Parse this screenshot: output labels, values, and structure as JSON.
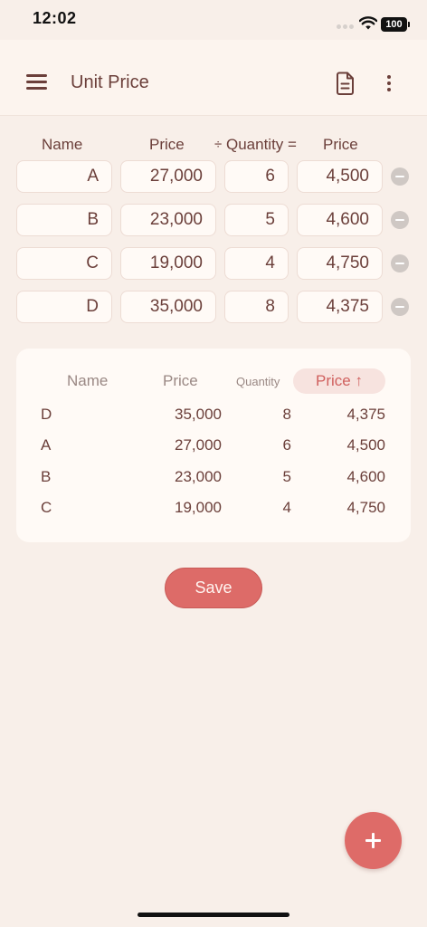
{
  "status_bar": {
    "time": "12:02",
    "battery": "100"
  },
  "app_bar": {
    "title": "Unit Price"
  },
  "input_table": {
    "headers": {
      "name": "Name",
      "price": "Price",
      "divide": "÷",
      "quantity": "Quantity",
      "equals": "=",
      "unit_price": "Price"
    },
    "rows": [
      {
        "name": "A",
        "price": "27,000",
        "quantity": "6",
        "unit_price": "4,500"
      },
      {
        "name": "B",
        "price": "23,000",
        "quantity": "5",
        "unit_price": "4,600"
      },
      {
        "name": "C",
        "price": "19,000",
        "quantity": "4",
        "unit_price": "4,750"
      },
      {
        "name": "D",
        "price": "35,000",
        "quantity": "8",
        "unit_price": "4,375"
      }
    ]
  },
  "sorted_table": {
    "headers": {
      "name": "Name",
      "price": "Price",
      "quantity": "Quantity",
      "unit_price": "Price ↑"
    },
    "rows": [
      {
        "name": "D",
        "price": "35,000",
        "quantity": "8",
        "unit_price": "4,375"
      },
      {
        "name": "A",
        "price": "27,000",
        "quantity": "6",
        "unit_price": "4,500"
      },
      {
        "name": "B",
        "price": "23,000",
        "quantity": "5",
        "unit_price": "4,600"
      },
      {
        "name": "C",
        "price": "19,000",
        "quantity": "4",
        "unit_price": "4,750"
      }
    ]
  },
  "save_label": "Save",
  "icons": {
    "menu": "hamburger-menu-icon",
    "document": "document-icon",
    "more": "more-vertical-icon",
    "remove": "remove-circle-icon",
    "add": "plus-icon"
  },
  "colors": {
    "accent": "#dd6b68",
    "background": "#f8efe9",
    "text": "#6b3f3a",
    "sort_chip": "#f7e3df"
  }
}
